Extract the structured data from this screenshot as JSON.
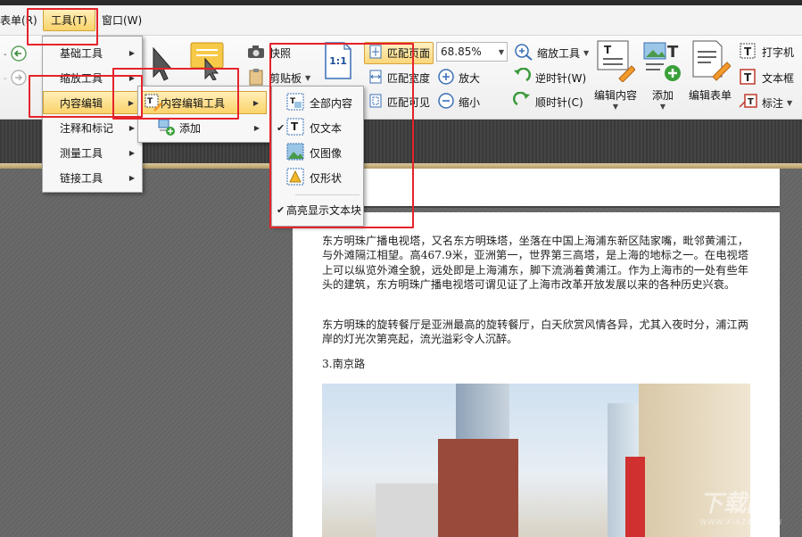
{
  "menubar": {
    "form": "表单(R)",
    "tools": "工具(T)",
    "window": "窗口(W)"
  },
  "ribbon": {
    "snapshot": "快照",
    "clipboard": "剪贴板",
    "fit_page": "匹配页面",
    "fit_width": "匹配宽度",
    "fit_visible": "匹配可见",
    "zoom_value": "68.85%",
    "zoom_tool": "缩放工具",
    "zoom_in": "放大",
    "zoom_out": "缩小",
    "rotate_ccw": "逆时针(W)",
    "rotate_cw": "顺时针(C)",
    "edit_content": "编辑内容",
    "add": "添加",
    "edit_form": "编辑表单",
    "typewriter": "打字机",
    "textbox": "文本框",
    "callout": "标注",
    "actual_size": "1:1"
  },
  "tools_menu": {
    "items": [
      "基础工具",
      "缩放工具",
      "内容编辑",
      "注释和标记",
      "测量工具",
      "链接工具"
    ]
  },
  "content_edit_menu": {
    "items": [
      "内容编辑工具",
      "添加"
    ]
  },
  "edit_tool_menu": {
    "items": [
      "全部内容",
      "仅文本",
      "仅图像",
      "仅形状"
    ],
    "highlight": "高亮显示文本块"
  },
  "document": {
    "para1": "东方明珠广播电视塔，又名东方明珠塔，坐落在中国上海浦东新区陆家嘴，毗邻黄浦江，与外滩隔江相望。高467.9米，亚洲第一，世界第三高塔，是上海的地标之一。在电视塔上可以纵览外滩全貌，远处即是上海浦东，脚下流淌着黄浦江。作为上海市的一处有些年头的建筑，东方明珠广播电视塔可谓见证了上海市改革开放发展以来的各种历史兴衰。",
    "para2": "东方明珠的旋转餐厅是亚洲最高的旋转餐厅，白天欣赏风情各异，尤其入夜时分，浦江两岸的灯光次第亮起，流光溢彩令人沉醉。",
    "heading": "3.南京路"
  },
  "watermark": {
    "main": "下载园",
    "sub": "WWW.XIAZAIBA.CN"
  },
  "colors": {
    "highlight_border": "#e5232b",
    "menu_hover": "#fbd36a"
  }
}
